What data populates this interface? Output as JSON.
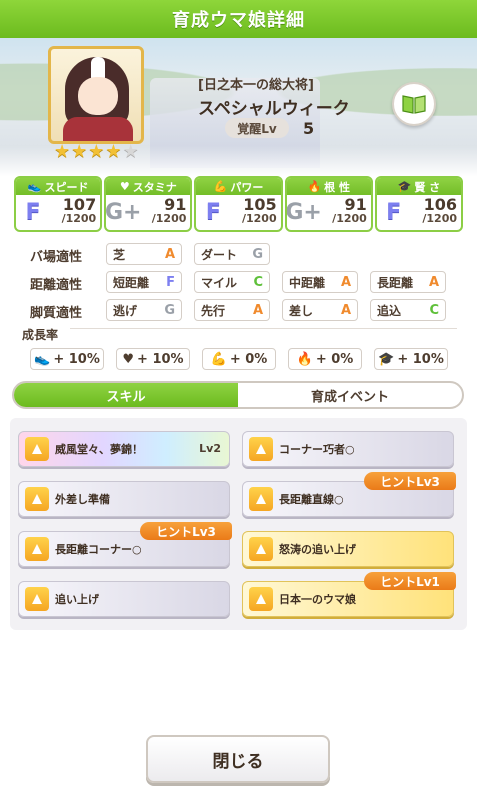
{
  "header": {
    "title": "育成ウマ娘詳細"
  },
  "profile": {
    "epithet": "[日之本一の総大将]",
    "name": "スペシャルウィーク",
    "awakening_label": "覚醒Lv",
    "awakening_level": "5",
    "stars": [
      true,
      true,
      true,
      true,
      false
    ]
  },
  "stats": [
    {
      "label": "スピード",
      "icon": "shoe-icon",
      "grade": "F",
      "value": "107",
      "max": "/1200"
    },
    {
      "label": "スタミナ",
      "icon": "heart-icon",
      "grade": "G+",
      "value": "91",
      "max": "/1200"
    },
    {
      "label": "パワー",
      "icon": "muscle-icon",
      "grade": "F",
      "value": "105",
      "max": "/1200"
    },
    {
      "label": "根 性",
      "icon": "flame-icon",
      "grade": "G+",
      "value": "91",
      "max": "/1200"
    },
    {
      "label": "賢 さ",
      "icon": "mortarboard-icon",
      "grade": "F",
      "value": "106",
      "max": "/1200"
    }
  ],
  "aptitude": {
    "track_label": "バ場適性",
    "track": [
      {
        "name": "芝",
        "rank": "A"
      },
      {
        "name": "ダート",
        "rank": "G"
      }
    ],
    "distance_label": "距離適性",
    "distance": [
      {
        "name": "短距離",
        "rank": "F"
      },
      {
        "name": "マイル",
        "rank": "C"
      },
      {
        "name": "中距離",
        "rank": "A"
      },
      {
        "name": "長距離",
        "rank": "A"
      }
    ],
    "style_label": "脚質適性",
    "style": [
      {
        "name": "逃げ",
        "rank": "G"
      },
      {
        "name": "先行",
        "rank": "A"
      },
      {
        "name": "差し",
        "rank": "A"
      },
      {
        "name": "追込",
        "rank": "C"
      }
    ]
  },
  "growth": {
    "label": "成長率",
    "items": [
      {
        "icon": "shoe-icon",
        "value": "+ 10%"
      },
      {
        "icon": "heart-icon",
        "value": "+ 10%"
      },
      {
        "icon": "muscle-icon",
        "value": "+ 0%"
      },
      {
        "icon": "flame-icon",
        "value": "+ 0%"
      },
      {
        "icon": "mortarboard-icon",
        "value": "+ 10%"
      }
    ]
  },
  "tabs": {
    "skill": "スキル",
    "event": "育成イベント"
  },
  "skills": [
    {
      "name": "威風堂々、夢錦！",
      "level": "Lv2",
      "hint": ""
    },
    {
      "name": "コーナー巧者○",
      "level": "",
      "hint": ""
    },
    {
      "name": "外差し準備",
      "level": "",
      "hint": ""
    },
    {
      "name": "長距離直線○",
      "level": "",
      "hint": "ヒントLv3"
    },
    {
      "name": "長距離コーナー○",
      "level": "",
      "hint": "ヒントLv3"
    },
    {
      "name": "怒涛の追い上げ",
      "level": "",
      "hint": ""
    },
    {
      "name": "追い上げ",
      "level": "",
      "hint": ""
    },
    {
      "name": "日本一のウマ娘",
      "level": "",
      "hint": "ヒントLv1"
    }
  ],
  "footer": {
    "close_label": "閉じる"
  },
  "colors": {
    "accent_green": "#7cc62c",
    "rank_a": "#f08a2d",
    "rank_c": "#5fc03a",
    "rank_f": "#7d7ff0",
    "rank_g": "#9aa0a8",
    "hint_orange": "#ef8a20"
  }
}
